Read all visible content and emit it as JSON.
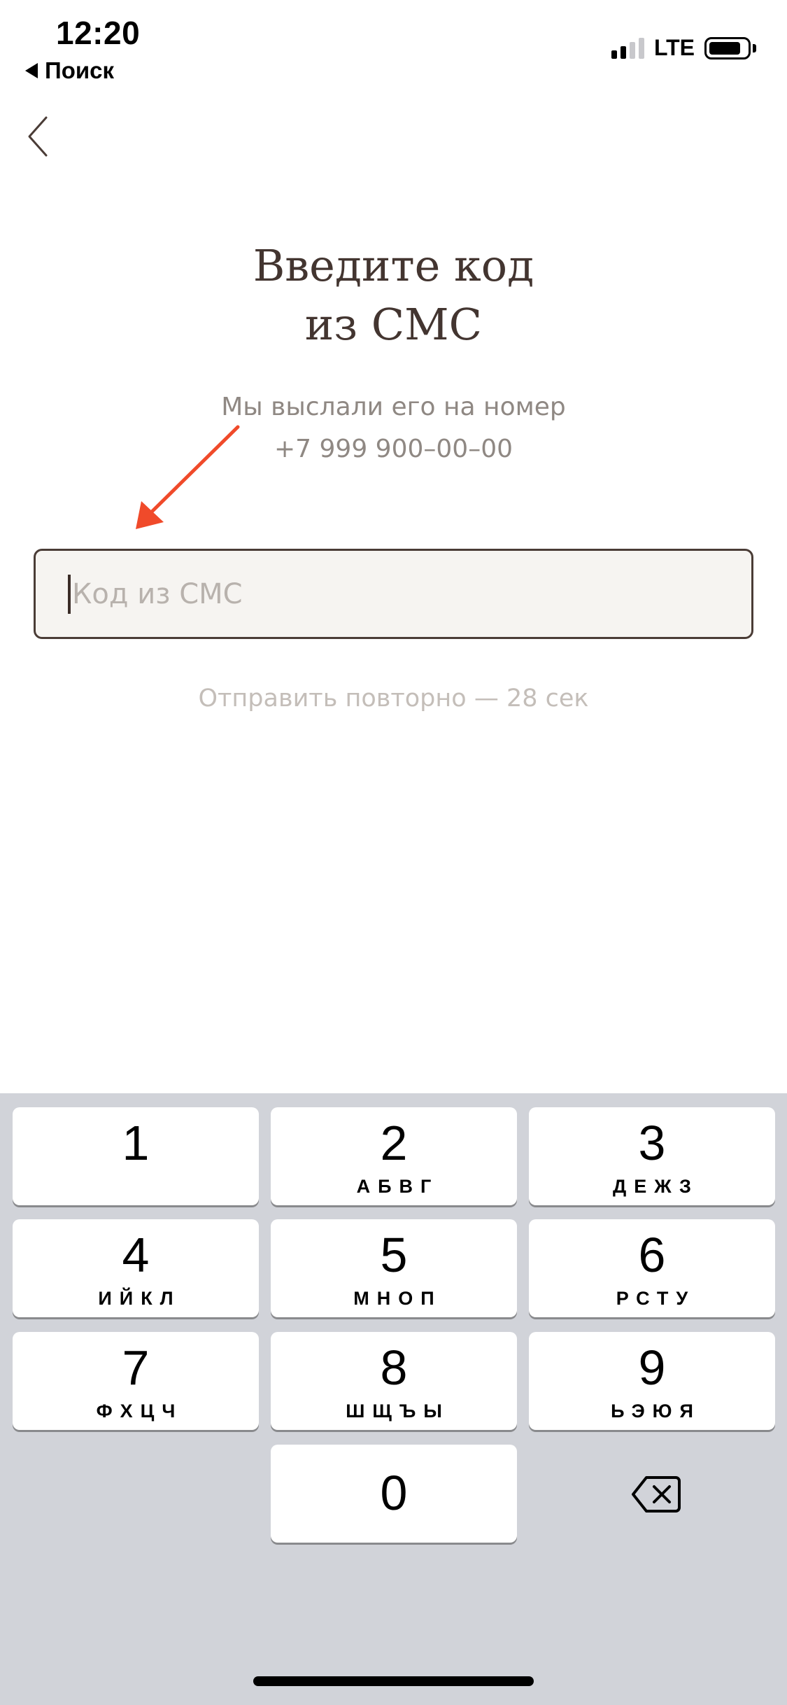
{
  "status_bar": {
    "time": "12:20",
    "back_app": "Поиск",
    "network": "LTE",
    "signal_icon": "signal-bars-icon",
    "battery_icon": "battery-icon"
  },
  "nav": {
    "back_icon": "chevron-left-icon"
  },
  "screen": {
    "title": "Введите код\nиз СМС",
    "subtitle_line1": "Мы выслали его на номер",
    "subtitle_line2": "+7 999 900–00–00"
  },
  "code_input": {
    "value": "",
    "placeholder": "Код из СМС"
  },
  "resend": {
    "label": "Отправить повторно — 28 сек"
  },
  "keypad": {
    "keys": [
      {
        "digit": "1",
        "letters": ""
      },
      {
        "digit": "2",
        "letters": "АБВГ"
      },
      {
        "digit": "3",
        "letters": "ДЕЖЗ"
      },
      {
        "digit": "4",
        "letters": "ИЙКЛ"
      },
      {
        "digit": "5",
        "letters": "МНОП"
      },
      {
        "digit": "6",
        "letters": "РСТУ"
      },
      {
        "digit": "7",
        "letters": "ФХЦЧ"
      },
      {
        "digit": "8",
        "letters": "ШЩЪЫ"
      },
      {
        "digit": "9",
        "letters": "ЬЭЮЯ"
      },
      {
        "digit": "0",
        "letters": ""
      }
    ],
    "delete_icon": "backspace-icon"
  },
  "colors": {
    "title": "#433530",
    "subtitle": "#8f8883",
    "input_border": "#4a3c36",
    "input_bg": "#f6f4f1",
    "resend": "#c4beb9",
    "annotation_arrow": "#f04a2a",
    "keypad_bg": "#d1d3d9"
  }
}
